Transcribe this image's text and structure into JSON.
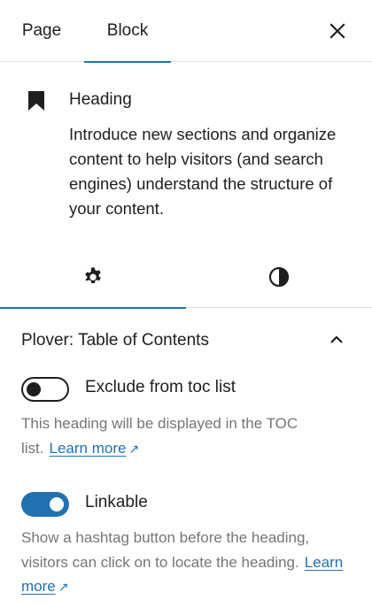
{
  "tabs": {
    "page": "Page",
    "block": "Block",
    "active": "Block"
  },
  "block_card": {
    "icon": "bookmark-icon",
    "title": "Heading",
    "description": "Introduce new sections and organize content to help visitors (and search engines) understand the structure of your content."
  },
  "inspector_tabs": [
    {
      "icon": "gear-icon",
      "active": true
    },
    {
      "icon": "contrast-icon",
      "active": false
    }
  ],
  "panel": {
    "title": "Plover: Table of Contents",
    "expanded": true,
    "exclude": {
      "label": "Exclude from toc list",
      "checked": false,
      "help": "This heading will be displayed in the TOC list.",
      "link": "Learn more",
      "link_icon": "↗"
    },
    "linkable": {
      "label": "Linkable",
      "checked": true,
      "help": "Show a hashtag button before the heading, visitors can click on to locate the heading.",
      "link": "Learn more",
      "link_icon": "↗"
    }
  },
  "colors": {
    "accent": "#2271b1",
    "text": "#1e1e1e",
    "muted": "#757575",
    "border": "#e0e0e0"
  }
}
